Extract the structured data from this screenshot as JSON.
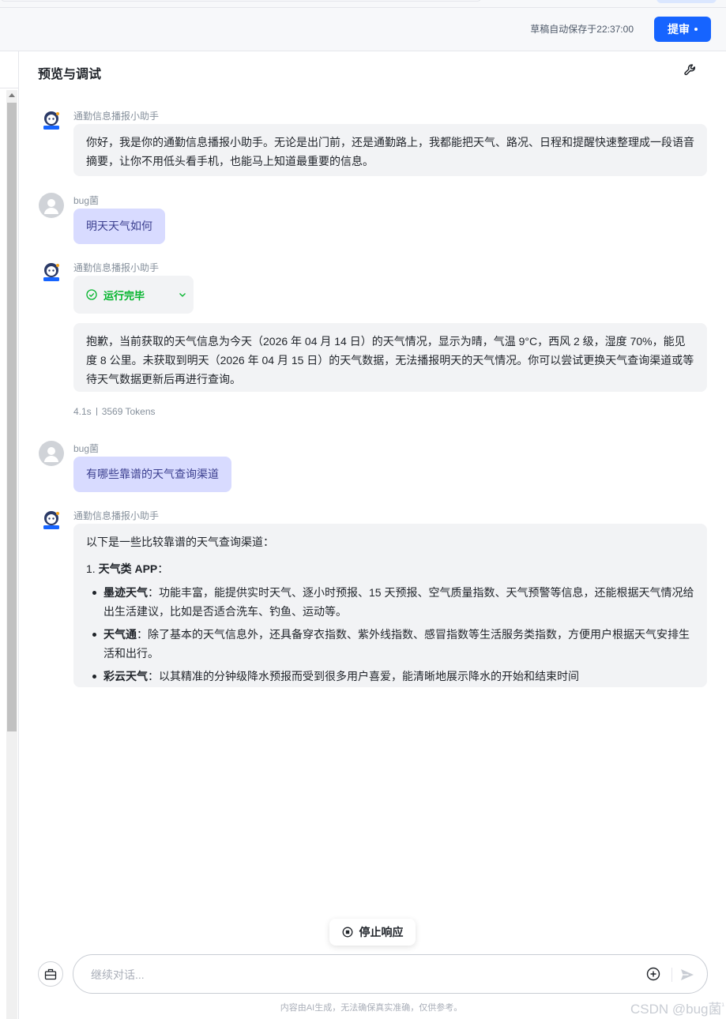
{
  "header": {
    "autosave_text": "草稿自动保存于22:37:00",
    "submit_label": "提审"
  },
  "panel": {
    "title": "预览与调试"
  },
  "messages": [
    {
      "sender": "通勤信息播报小助手",
      "role": "bot",
      "text": "你好，我是你的通勤信息播报小助手。无论是出门前，还是通勤路上，我都能把天气、路况、日程和提醒快速整理成一段语音摘要，让你不用低头看手机，也能马上知道最重要的信息。"
    },
    {
      "sender": "bug菌",
      "role": "user",
      "text": "明天天气如何"
    },
    {
      "sender": "通勤信息播报小助手",
      "role": "bot",
      "run_status": "运行完毕",
      "text": "抱歉，当前获取的天气信息为今天（2026 年 04 月 14 日）的天气情况，显示为晴，气温 9°C，西风 2 级，湿度 70%，能见度 8 公里。未获取到明天（2026 年 04 月 15 日）的天气数据，无法播报明天的天气情况。你可以尝试更换天气查询渠道或等待天气数据更新后再进行查询。",
      "meta": {
        "duration": "4.1s",
        "tokens": "3569 Tokens"
      }
    },
    {
      "sender": "bug菌",
      "role": "user",
      "text": "有哪些靠谱的天气查询渠道"
    },
    {
      "sender": "通勤信息播报小助手",
      "role": "bot",
      "intro": "以下是一些比较靠谱的天气查询渠道：",
      "list_number": "1.",
      "list_title": "天气类 APP",
      "list_title_suffix": "：",
      "items": [
        {
          "name": "墨迹天气",
          "desc": "：功能丰富，能提供实时天气、逐小时预报、15 天预报、空气质量指数、天气预警等信息，还能根据天气情况给出生活建议，比如是否适合洗车、钓鱼、运动等。"
        },
        {
          "name": "天气通",
          "desc": "：除了基本的天气信息外，还具备穿衣指数、紫外线指数、感冒指数等生活服务类指数，方便用户根据天气安排生活和出行。"
        },
        {
          "name": "彩云天气",
          "desc": "：以其精准的分钟级降水预报而受到很多用户喜爱，能清晰地展示降水的开始和结束时间"
        }
      ]
    }
  ],
  "stop_button": {
    "label": "停止响应"
  },
  "input": {
    "placeholder": "继续对话..."
  },
  "footer": {
    "disclaimer": "内容由AI生成，无法确保真实准确，仅供参考。",
    "watermark": "CSDN @bug菌",
    "watermark_sup": "¹"
  },
  "colors": {
    "accent": "#1664ff",
    "success": "#00b42a",
    "user_bubble": "#d8dbff",
    "bot_bubble": "#f2f3f5"
  }
}
